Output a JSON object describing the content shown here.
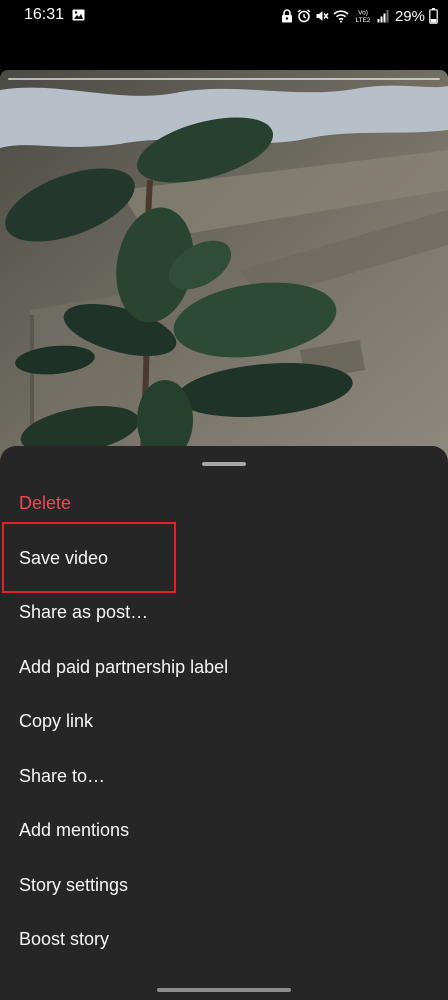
{
  "status_bar": {
    "time": "16:31",
    "left_icons": [
      "image-icon"
    ],
    "right_icons": [
      "lock-icon",
      "alarm-icon",
      "mute-icon",
      "wifi-icon",
      "volte-icon",
      "signal-icon"
    ],
    "volte_label_top": "Vo)",
    "volte_label_bottom": "LTE2",
    "battery": "29%"
  },
  "story": {
    "image_description": "plant-photo"
  },
  "sheet": {
    "items": [
      {
        "label": "Delete",
        "style": "danger"
      },
      {
        "label": "Save video",
        "style": "normal",
        "highlighted": true
      },
      {
        "label": "Share as post…",
        "style": "normal"
      },
      {
        "label": "Add paid partnership label",
        "style": "normal"
      },
      {
        "label": "Copy link",
        "style": "normal"
      },
      {
        "label": "Share to…",
        "style": "normal"
      },
      {
        "label": "Add mentions",
        "style": "normal"
      },
      {
        "label": "Story settings",
        "style": "normal"
      },
      {
        "label": "Boost story",
        "style": "normal"
      }
    ]
  },
  "colors": {
    "danger": "#ed4956",
    "sheet_bg": "#262626",
    "highlight": "#e0222b"
  }
}
